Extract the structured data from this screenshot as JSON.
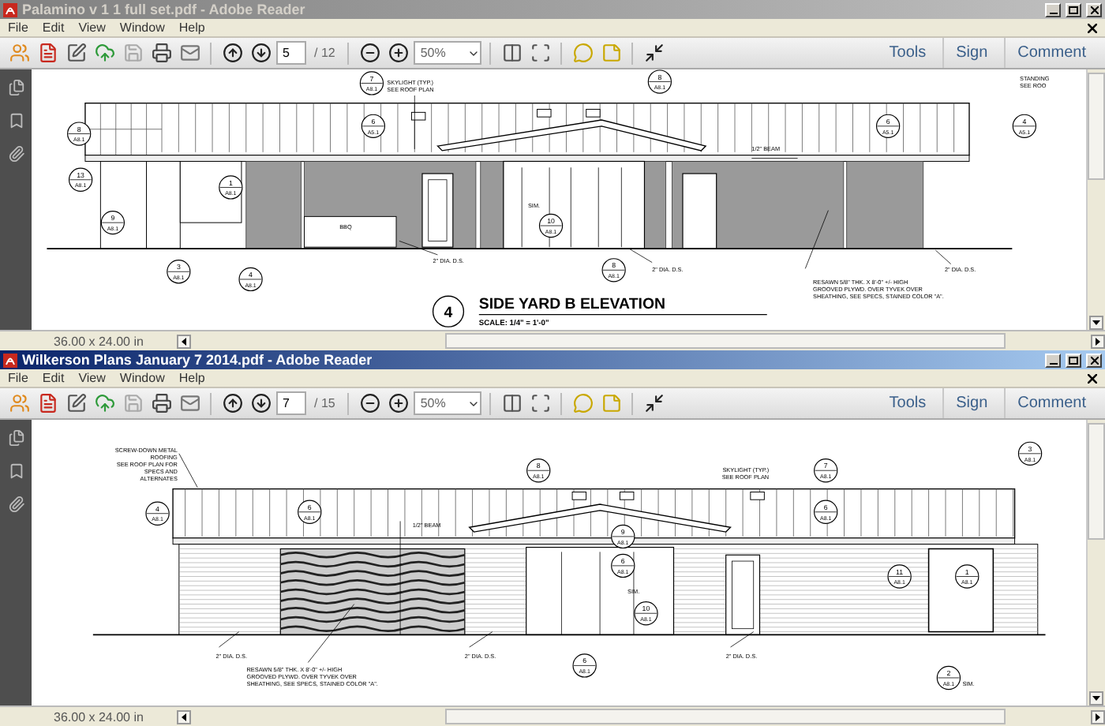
{
  "windows": [
    {
      "title": "Palamino v 1 1 full set.pdf - Adobe Reader",
      "active": false,
      "menu": [
        "File",
        "Edit",
        "View",
        "Window",
        "Help"
      ],
      "page": "5",
      "page_total": "/ 12",
      "zoom": "50%",
      "panes": [
        "Tools",
        "Sign",
        "Comment"
      ],
      "page_size": "36.00 x 24.00 in",
      "drawing": {
        "kind": "stucco",
        "title_number": "4",
        "title": "SIDE YARD B ELEVATION",
        "scale": "SCALE: 1/4\" = 1'-0\"",
        "callouts": [
          {
            "number": "8",
            "sheet": "A8.1"
          },
          {
            "number": "13",
            "sheet": "A8.1"
          },
          {
            "number": "9",
            "sheet": "A8.1"
          },
          {
            "number": "3",
            "sheet": "A8.1"
          },
          {
            "number": "4",
            "sheet": "A8.1"
          },
          {
            "number": "7",
            "sheet": "A8.1"
          },
          {
            "number": "6",
            "sheet": "A5.1"
          },
          {
            "number": "1",
            "sheet": "A8.1"
          },
          {
            "number": "8",
            "sheet": "A8.1"
          },
          {
            "number": "10",
            "sheet": "A8.1"
          },
          {
            "number": "8",
            "sheet": "A8.1"
          },
          {
            "number": "6",
            "sheet": "A5.1"
          },
          {
            "number": "4",
            "sheet": "A5.1"
          }
        ],
        "notes": [
          {
            "lines": [
              "SKYLIGHT (TYP.)",
              "SEE ROOF PLAN"
            ]
          },
          {
            "lines": [
              "1/2\" BEAM"
            ]
          },
          {
            "lines": [
              "BBQ"
            ]
          },
          {
            "lines": [
              "SIM."
            ]
          },
          {
            "lines": [
              "2\" DIA. D.S."
            ]
          },
          {
            "lines": [
              "2\" DIA. D.S."
            ]
          },
          {
            "lines": [
              "2\" DIA. D.S."
            ]
          },
          {
            "lines": [
              "RESAWN 5/8\" THK. X 8'-0\" +/- HIGH",
              "GROOVED PLYWD. OVER TYVEK OVER",
              "SHEATHING, SEE SPECS, STAINED COLOR \"A\"."
            ]
          },
          {
            "lines": [
              "STANDING",
              "SEE ROO"
            ]
          }
        ]
      }
    },
    {
      "title": "Wilkerson Plans January 7 2014.pdf - Adobe Reader",
      "active": true,
      "menu": [
        "File",
        "Edit",
        "View",
        "Window",
        "Help"
      ],
      "page": "7",
      "page_total": "/ 15",
      "zoom": "50%",
      "panes": [
        "Tools",
        "Sign",
        "Comment"
      ],
      "page_size": "36.00 x 24.00 in",
      "drawing": {
        "kind": "siding",
        "callouts": [
          {
            "number": "4",
            "sheet": "A8.1"
          },
          {
            "number": "6",
            "sheet": "A8.1"
          },
          {
            "number": "8",
            "sheet": "A8.1"
          },
          {
            "number": "9",
            "sheet": "A8.1"
          },
          {
            "number": "6",
            "sheet": "A8.1"
          },
          {
            "number": "10",
            "sheet": "A8.1"
          },
          {
            "number": "7",
            "sheet": "A8.1"
          },
          {
            "number": "6",
            "sheet": "A8.1"
          },
          {
            "number": "3",
            "sheet": "A8.1"
          },
          {
            "number": "11",
            "sheet": "A8.1"
          },
          {
            "number": "1",
            "sheet": "A8.1"
          },
          {
            "number": "6",
            "sheet": "A8.1"
          },
          {
            "number": "2",
            "sheet": "A8.1"
          }
        ],
        "notes": [
          {
            "lines": [
              "SCREW-DOWN METAL",
              "ROOFING",
              "SEE ROOF PLAN FOR",
              "SPECS AND",
              "ALTERNATES"
            ]
          },
          {
            "lines": [
              "SKYLIGHT (TYP.)",
              "SEE ROOF PLAN"
            ]
          },
          {
            "lines": [
              "1/2\" BEAM"
            ]
          },
          {
            "lines": [
              "SIM."
            ]
          },
          {
            "lines": [
              "2\" DIA. D.S."
            ]
          },
          {
            "lines": [
              "2\" DIA. D.S."
            ]
          },
          {
            "lines": [
              "2\" DIA. D.S."
            ]
          },
          {
            "lines": [
              "RESAWN 5/8\" THK. X 8'-0\" +/- HIGH",
              "GROOVED PLYWD. OVER TYVEK OVER",
              "SHEATHING, SEE SPECS, STAINED COLOR \"A\"."
            ]
          },
          {
            "lines": [
              "SIM."
            ]
          }
        ]
      }
    }
  ]
}
